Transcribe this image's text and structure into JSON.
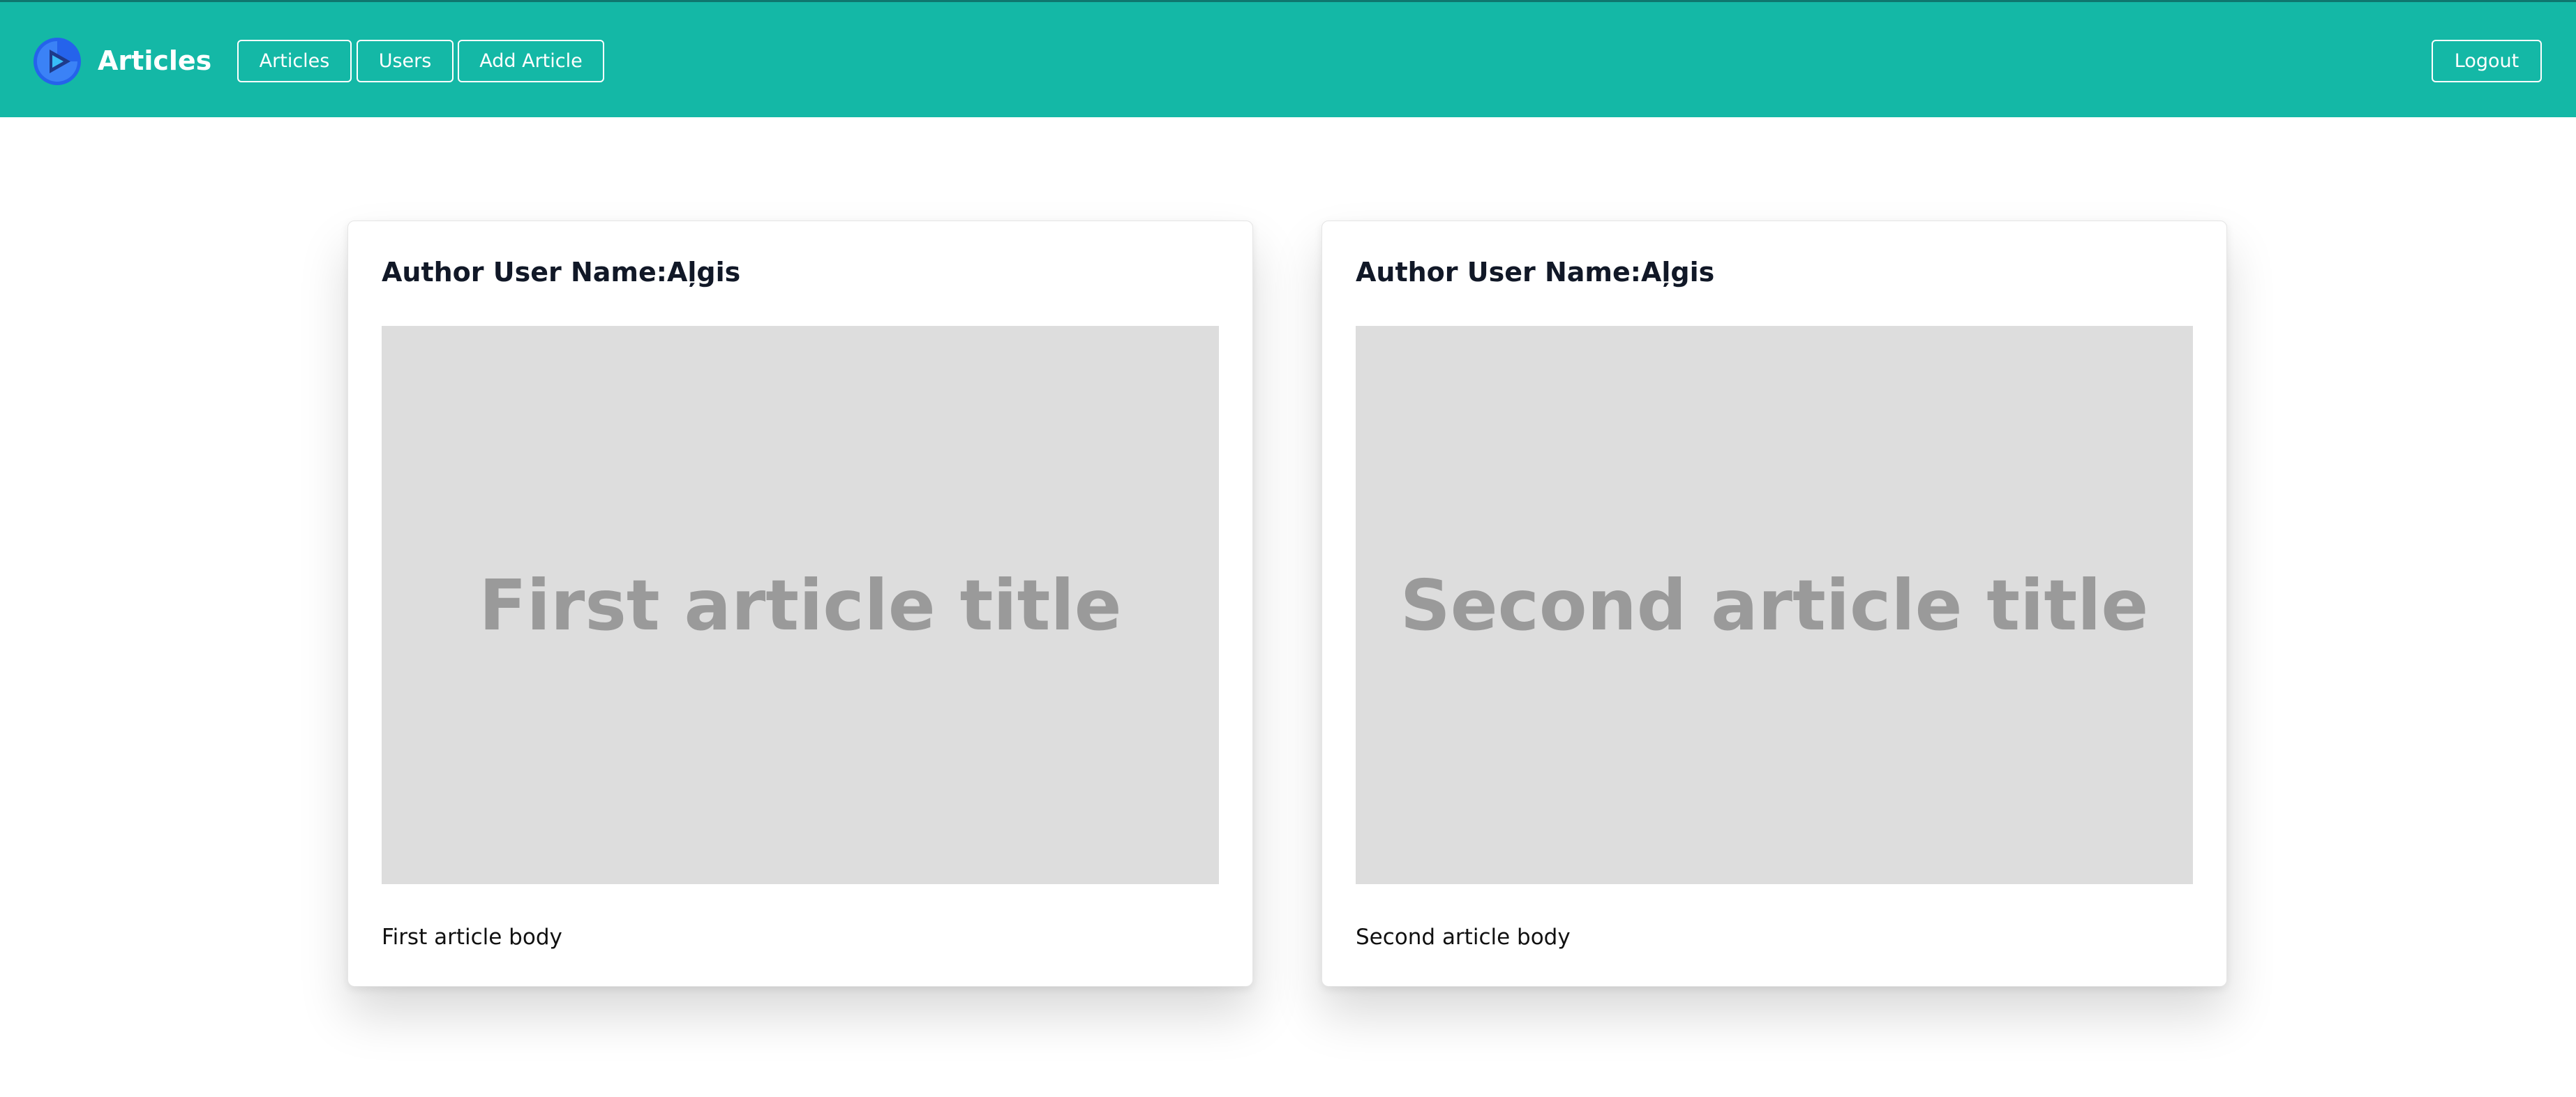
{
  "header": {
    "brand": "Articles",
    "logo_icon": "play-logo-icon",
    "brand_color": "#14b8a6",
    "nav": {
      "articles": "Articles",
      "users": "Users",
      "add_article": "Add Article"
    },
    "logout": "Logout"
  },
  "articles": [
    {
      "author": "Author User Name:Aļgis",
      "image_text": "First article title",
      "body": "First article body"
    },
    {
      "author": "Author User Name:Aļgis",
      "image_text": "Second article title",
      "body": "Second article body"
    }
  ]
}
